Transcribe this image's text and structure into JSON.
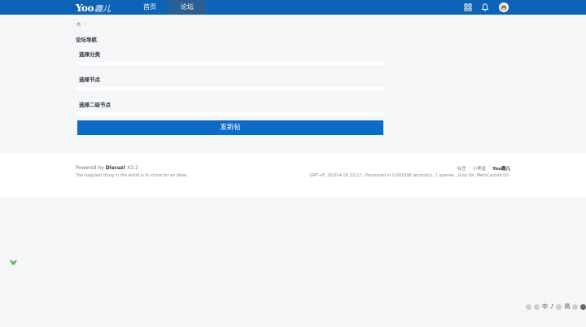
{
  "header": {
    "logo_latin": "Yoo",
    "logo_cn": "趣儿",
    "nav": [
      {
        "label": "首页",
        "active": false
      },
      {
        "label": "论坛",
        "active": true
      }
    ],
    "icons": [
      "apps-grid-icon",
      "notification-bell-icon",
      "user-avatar"
    ]
  },
  "breadcrumb": {
    "home_icon": "home-icon",
    "separator": "›"
  },
  "forum_nav": {
    "title": "论坛导航",
    "select_category_label": "选择分类",
    "select_node_label": "选择节点",
    "select_subnode_label": "选择二级节点",
    "submit_button": "发新帖"
  },
  "footer": {
    "powered_prefix": "Powered by ",
    "powered_name": "Discuz!",
    "powered_version": " X3.2",
    "tagline": "The happiest thing in the world is to strive for an ideal.",
    "links": [
      "标签",
      "小黑屋",
      "Yoo趣儿"
    ],
    "stats": "GMT+8, 2020-4-26 23:22 , Processed in 0.001098 second(s), 1 queries , Gzip On, MemCached On."
  },
  "ime_bar": {
    "items": [
      "中",
      "♪",
      "简"
    ]
  },
  "colors": {
    "brand": "#0d63b5",
    "button": "#0d6ac7",
    "active_nav": "#2a5f94"
  }
}
